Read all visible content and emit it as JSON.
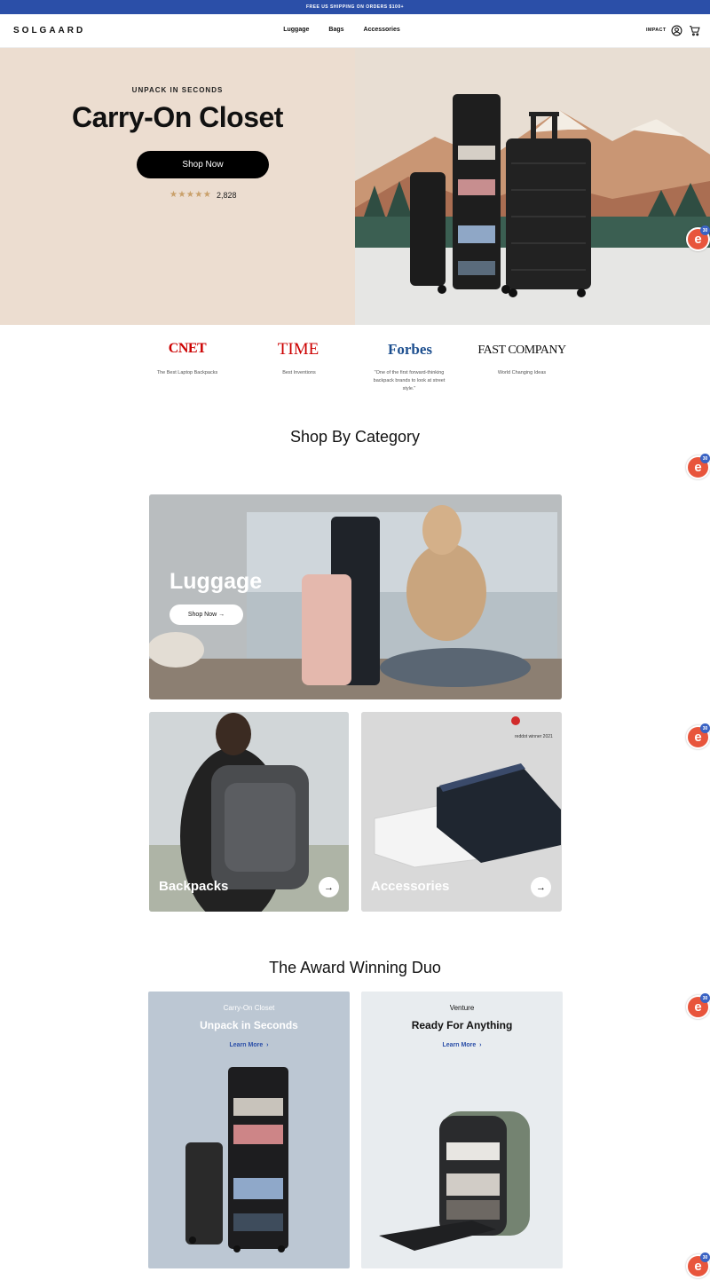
{
  "promo": {
    "text": "FREE US SHIPPING ON ORDERS $100+"
  },
  "header": {
    "logo": "SOLGAARD",
    "nav": [
      "Luggage",
      "Bags",
      "Accessories"
    ],
    "impact": "IMPACT"
  },
  "hero": {
    "eyebrow": "UNPACK IN SECONDS",
    "title": "Carry-On Closet",
    "cta": "Shop Now",
    "rating": 5,
    "review_count": "2,828"
  },
  "press": [
    {
      "name": "CNET",
      "caption": "The Best Laptop Backpacks"
    },
    {
      "name": "TIME",
      "caption": "Best Inventions"
    },
    {
      "name": "Forbes",
      "caption": "\"One of the first forward-thinking backpack brands to look at street style.\""
    },
    {
      "name": "FAST COMPANY",
      "caption": "World Changing Ideas"
    }
  ],
  "categories": {
    "title": "Shop By Category",
    "luggage": {
      "label": "Luggage",
      "cta": "Shop Now"
    },
    "backpacks": {
      "label": "Backpacks"
    },
    "accessories": {
      "label": "Accessories",
      "award": "reddot winner 2021"
    }
  },
  "duo": {
    "title": "The Award Winning Duo",
    "items": [
      {
        "eyebrow": "Carry-On Closet",
        "title": "Unpack in Seconds",
        "link": "Learn More"
      },
      {
        "eyebrow": "Venture",
        "title": "Ready For Anything",
        "link": "Learn More"
      }
    ]
  },
  "badge": {
    "count": "30"
  },
  "colors": {
    "promo": "#2b4fa8",
    "hero_bg": "#ecddd0",
    "cta": "#000000",
    "link": "#2b4fa8",
    "badge": "#e8553c"
  }
}
